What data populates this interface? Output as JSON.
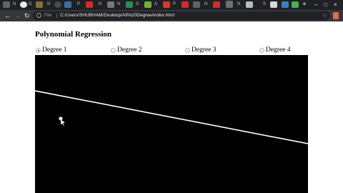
{
  "browser": {
    "tab_letters": [
      "N",
      "G",
      "N",
      "P",
      "N",
      "N",
      "N",
      "G",
      "A",
      "P",
      "A",
      "N",
      "N",
      "V",
      "S"
    ],
    "file_label": "File",
    "url": "C:/Users/SHUBHAM/Desktop/All%20Degree/index.html",
    "new_tab": "+",
    "window_controls": [
      "–",
      "□",
      "×"
    ]
  },
  "page": {
    "title": "Polynomial Regression",
    "options": [
      {
        "label": "Degree 1",
        "checked": true
      },
      {
        "label": "Degree 2",
        "checked": false
      },
      {
        "label": "Degree 3",
        "checked": false
      },
      {
        "label": "Degree 4",
        "checked": false
      }
    ]
  },
  "canvas": {
    "background": "#000000",
    "line_color": "#ffffff",
    "point_color": "#ffffff",
    "points_count_visible": 1
  }
}
